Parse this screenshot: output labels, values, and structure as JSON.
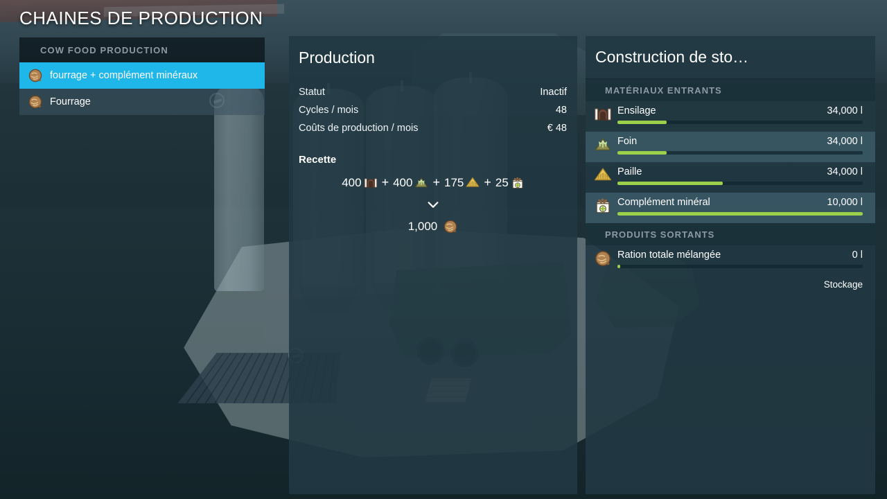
{
  "page": {
    "title": "CHAINES DE PRODUCTION"
  },
  "colors": {
    "accent_selected": "#1fb6ea",
    "bar_fill": "#9bd14a",
    "panel_bg": "#213842",
    "section_label": "#8c9ba3"
  },
  "sidebar": {
    "group_label": "COW FOOD PRODUCTION",
    "items": [
      {
        "label": "fourrage + complément minéraux",
        "icon": "forage-ball-icon",
        "selected": true
      },
      {
        "label": "Fourrage",
        "icon": "forage-ball-icon",
        "selected": false
      }
    ]
  },
  "production": {
    "title": "Production",
    "stats": [
      {
        "label": "Statut",
        "value": "Inactif"
      },
      {
        "label": "Cycles / mois",
        "value": "48"
      },
      {
        "label": "Coûts de production / mois",
        "value": "€ 48"
      }
    ],
    "recipe": {
      "title": "Recette",
      "inputs": [
        {
          "amount": "400",
          "icon": "silage-icon"
        },
        {
          "amount": "400",
          "icon": "hay-icon"
        },
        {
          "amount": "175",
          "icon": "straw-icon"
        },
        {
          "amount": "25",
          "icon": "mineral-feed-icon"
        }
      ],
      "plus_symbol": "+",
      "arrow_symbol": "⌄",
      "output": {
        "amount": "1,000",
        "icon": "forage-ball-icon"
      }
    }
  },
  "storage": {
    "title": "Construction de sto…",
    "sections": [
      {
        "label": "MATÉRIAUX ENTRANTS",
        "rows": [
          {
            "name": "Ensilage",
            "value": "34,000 l",
            "fill": 20,
            "icon": "silage-icon",
            "alt": false
          },
          {
            "name": "Foin",
            "value": "34,000 l",
            "fill": 20,
            "icon": "hay-icon",
            "alt": true
          },
          {
            "name": "Paille",
            "value": "34,000 l",
            "fill": 43,
            "icon": "straw-icon",
            "alt": false
          },
          {
            "name": "Complément minéral",
            "value": "10,000 l",
            "fill": 100,
            "icon": "mineral-feed-icon",
            "alt": true
          }
        ]
      },
      {
        "label": "PRODUITS SORTANTS",
        "rows": [
          {
            "name": "Ration totale mélangée",
            "value": "0 l",
            "fill": 1,
            "icon": "forage-ball-icon",
            "alt": false
          }
        ]
      }
    ],
    "storage_note": "Stockage"
  }
}
